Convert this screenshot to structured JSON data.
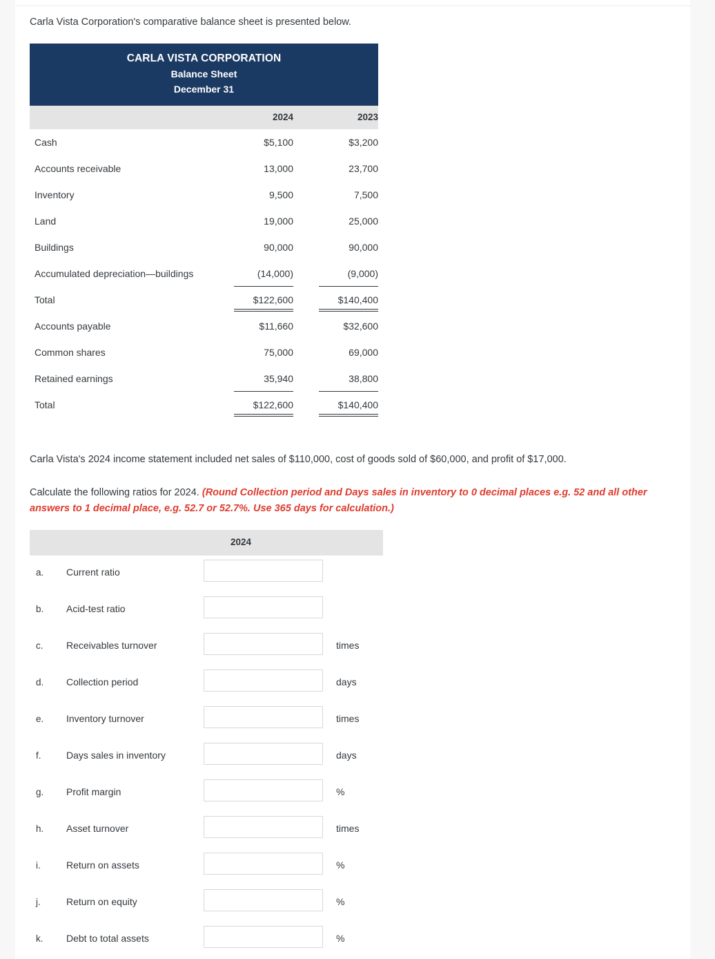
{
  "intro": "Carla Vista Corporation's comparative balance sheet is presented below.",
  "balance_sheet": {
    "company": "CARLA VISTA CORPORATION",
    "statement": "Balance Sheet",
    "date": "December 31",
    "columns": [
      "2024",
      "2023"
    ],
    "rows": [
      {
        "label": "Cash",
        "y2024": "$5,100",
        "y2023": "$3,200"
      },
      {
        "label": "Accounts receivable",
        "y2024": "13,000",
        "y2023": "23,700"
      },
      {
        "label": "Inventory",
        "y2024": "9,500",
        "y2023": "7,500"
      },
      {
        "label": "Land",
        "y2024": "19,000",
        "y2023": "25,000"
      },
      {
        "label": "Buildings",
        "y2024": "90,000",
        "y2023": "90,000"
      },
      {
        "label": "Accumulated depreciation—buildings",
        "y2024": "(14,000)",
        "y2023": "(9,000)"
      },
      {
        "label": "Total",
        "y2024": "$122,600",
        "y2023": "$140,400"
      },
      {
        "label": "Accounts payable",
        "y2024": "$11,660",
        "y2023": "$32,600"
      },
      {
        "label": "Common shares",
        "y2024": "75,000",
        "y2023": "69,000"
      },
      {
        "label": "Retained earnings",
        "y2024": "35,940",
        "y2023": "38,800"
      },
      {
        "label": "Total",
        "y2024": "$122,600",
        "y2023": "$140,400"
      }
    ]
  },
  "narrative": "Carla Vista's 2024 income statement included net sales of $110,000, cost of goods sold of $60,000, and profit of $17,000.",
  "instruction": {
    "lead": "Calculate the following ratios for 2024. ",
    "hint": "(Round Collection period and Days sales in inventory to 0 decimal places e.g. 52 and all other answers to 1 decimal place, e.g. 52.7 or 52.7%. Use 365 days for calculation.)"
  },
  "ratios": {
    "column_header": "2024",
    "rows": [
      {
        "letter": "a.",
        "label": "Current ratio",
        "value": "",
        "unit": ""
      },
      {
        "letter": "b.",
        "label": "Acid-test ratio",
        "value": "",
        "unit": ""
      },
      {
        "letter": "c.",
        "label": "Receivables turnover",
        "value": "",
        "unit": "times"
      },
      {
        "letter": "d.",
        "label": "Collection period",
        "value": "",
        "unit": "days"
      },
      {
        "letter": "e.",
        "label": "Inventory turnover",
        "value": "",
        "unit": "times"
      },
      {
        "letter": "f.",
        "label": "Days sales in inventory",
        "value": "",
        "unit": "days"
      },
      {
        "letter": "g.",
        "label": "Profit margin",
        "value": "",
        "unit": "%"
      },
      {
        "letter": "h.",
        "label": "Asset turnover",
        "value": "",
        "unit": "times"
      },
      {
        "letter": "i.",
        "label": "Return on assets",
        "value": "",
        "unit": "%"
      },
      {
        "letter": "j.",
        "label": "Return on equity",
        "value": "",
        "unit": "%"
      },
      {
        "letter": "k.",
        "label": "Debt to total assets",
        "value": "",
        "unit": "%"
      }
    ]
  },
  "colors": {
    "header_navy": "#1b3a63",
    "band_gray": "#e4e4e4",
    "hint_red": "#de3b2d",
    "text": "#33383d"
  }
}
